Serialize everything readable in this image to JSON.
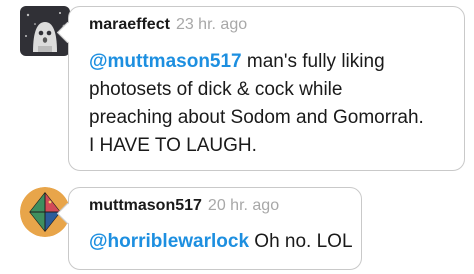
{
  "comments": [
    {
      "username": "maraeffect",
      "time": "23 hr. ago",
      "mention": "@muttmason517",
      "lines": [
        " man's fully liking",
        "photosets of dick & cock while",
        "preaching about Sodom and Gomorrah.",
        "I HAVE TO LAUGH."
      ]
    },
    {
      "username": "muttmason517",
      "time": "20 hr. ago",
      "mention": "@horriblewarlock",
      "lines": [
        " Oh no. LOL"
      ]
    }
  ],
  "colors": {
    "mention": "#1d8fe0",
    "border": "#c9c9c9",
    "timestamp": "#a8a8a8",
    "avatar1_bg": "#303036",
    "avatar2_bg": "#e8a54a"
  },
  "icons": [
    "ghost-avatar-icon",
    "diamond-avatar-icon"
  ]
}
